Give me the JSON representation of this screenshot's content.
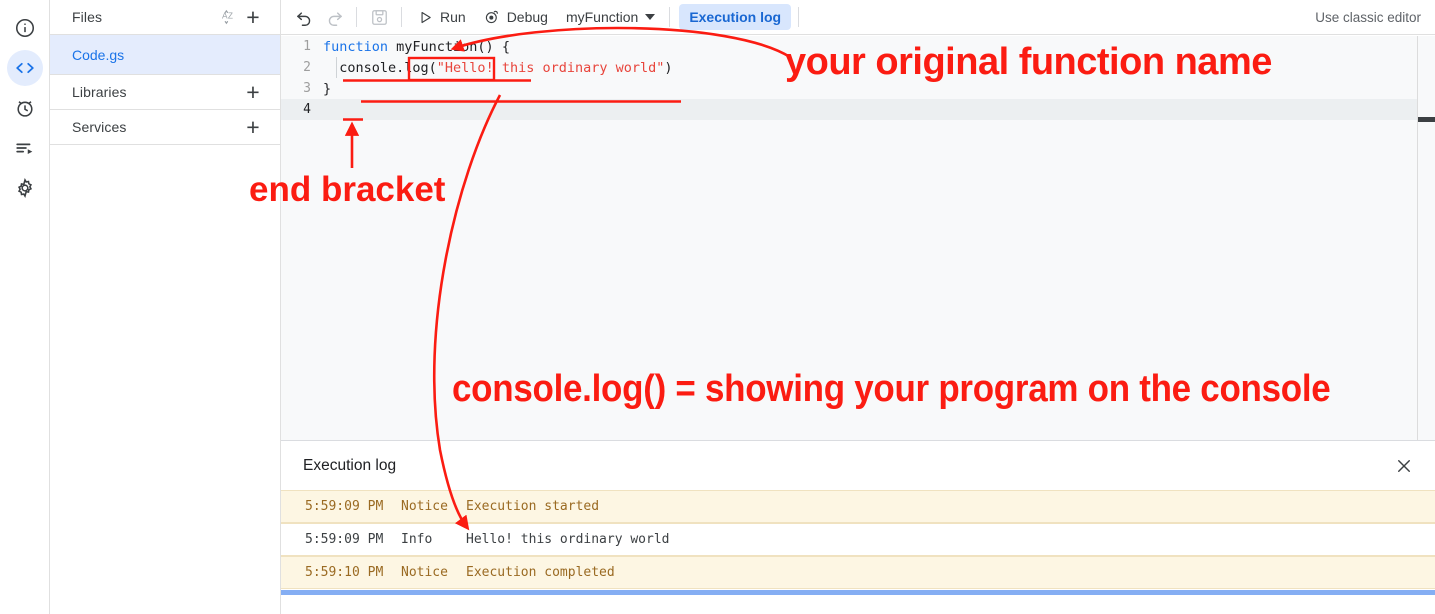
{
  "rail": {
    "items": [
      {
        "name": "overview-icon",
        "label": "Overview",
        "active": false
      },
      {
        "name": "code-editor-icon",
        "label": "Editor",
        "active": true
      },
      {
        "name": "triggers-alarm-icon",
        "label": "Triggers",
        "active": false
      },
      {
        "name": "executions-list-icon",
        "label": "Executions",
        "active": false
      },
      {
        "name": "gear-icon",
        "label": "Project Settings",
        "active": false
      }
    ]
  },
  "sidebar": {
    "files": {
      "title": "Files",
      "sort_label": "A↕Z",
      "add_label": "+",
      "items": [
        {
          "label": "Code.gs",
          "selected": true
        }
      ]
    },
    "libraries": {
      "title": "Libraries",
      "add_label": "+"
    },
    "services": {
      "title": "Services",
      "add_label": "+"
    }
  },
  "toolbar": {
    "undo_label": "Undo",
    "redo_label": "Redo",
    "save_label": "Save project",
    "run_label": "Run",
    "debug_label": "Debug",
    "function_selector": "myFunction",
    "execution_log_tab": "Execution log",
    "classic_editor": "Use classic editor"
  },
  "editor": {
    "lines": [
      {
        "number": "1",
        "tokens": [
          {
            "t": "function ",
            "c": "kw"
          },
          {
            "t": "myFunction() {",
            "c": ""
          }
        ],
        "active": false
      },
      {
        "number": "2",
        "tokens": [
          {
            "t": "  console.log(",
            "c": ""
          },
          {
            "t": "\"Hello! this ordinary world\"",
            "c": "str"
          },
          {
            "t": ")",
            "c": ""
          }
        ],
        "active": false
      },
      {
        "number": "3",
        "tokens": [
          {
            "t": "}",
            "c": ""
          }
        ],
        "active": false
      },
      {
        "number": "4",
        "tokens": [
          {
            "t": "",
            "c": ""
          }
        ],
        "active": true
      }
    ]
  },
  "log": {
    "title": "Execution log",
    "close_label": "×",
    "rows": [
      {
        "timestamp": "5:59:09 PM",
        "level": "Notice",
        "message": "Execution started",
        "kind": "notice"
      },
      {
        "timestamp": "5:59:09 PM",
        "level": "Info",
        "message": "Hello! this ordinary world",
        "kind": "info"
      },
      {
        "timestamp": "5:59:10 PM",
        "level": "Notice",
        "message": "Execution completed",
        "kind": "notice"
      }
    ]
  },
  "annotations": {
    "color": "#fb1c12",
    "function_name": "your original function name",
    "end_bracket": "end bracket",
    "console_log": "console.log() = showing your program on the console"
  },
  "colors": {
    "accent_blue": "#1a73e8",
    "selected_file_bg": "#e4ecfd",
    "pill_bg": "#d8e6fd",
    "editor_bg": "#f8f9fa",
    "notice_row_bg": "#fdf6e3",
    "notice_text": "#9a6a22",
    "blue_bar": "#85aef3",
    "annotation_red": "#fb1c12"
  }
}
